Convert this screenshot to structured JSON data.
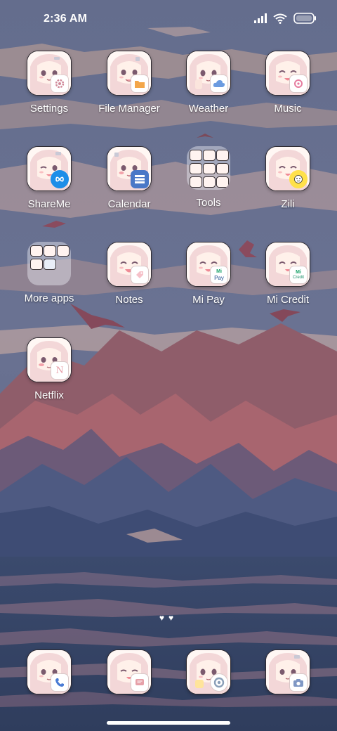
{
  "status_bar": {
    "time": "2:36 AM"
  },
  "apps": [
    {
      "id": "settings",
      "label": "Settings",
      "badge_icon": "gear-icon"
    },
    {
      "id": "file-manager",
      "label": "File Manager",
      "badge_icon": "folder-icon"
    },
    {
      "id": "weather",
      "label": "Weather",
      "badge_icon": "cloud-icon"
    },
    {
      "id": "music",
      "label": "Music",
      "badge_icon": "music-icon"
    },
    {
      "id": "shareme",
      "label": "ShareMe",
      "badge_icon": "infinity-icon"
    },
    {
      "id": "calendar",
      "label": "Calendar",
      "badge_icon": "calendar-icon"
    },
    {
      "id": "tools",
      "label": "Tools",
      "badge_icon": "folder-grid-icon"
    },
    {
      "id": "zili",
      "label": "Zili",
      "badge_icon": "zili-icon"
    },
    {
      "id": "more-apps",
      "label": "More apps",
      "badge_icon": "folder-grid-icon"
    },
    {
      "id": "notes",
      "label": "Notes",
      "badge_icon": "tag-icon"
    },
    {
      "id": "mi-pay",
      "label": "Mi Pay",
      "badge_text": "Pay"
    },
    {
      "id": "mi-credit",
      "label": "Mi Credit",
      "badge_text": "Credit"
    },
    {
      "id": "netflix",
      "label": "Netflix",
      "badge_text": "N"
    }
  ],
  "dock": [
    {
      "id": "phone",
      "badge_icon": "phone-icon"
    },
    {
      "id": "messages",
      "badge_icon": "message-icon"
    },
    {
      "id": "browser",
      "badge_icon": "browser-icon"
    },
    {
      "id": "camera",
      "badge_icon": "camera-icon"
    }
  ],
  "pager": {
    "dots": "♥♥"
  },
  "colors": {
    "sky": "#67708f",
    "cloud": "#b79e9e",
    "mountain": "#a8656f",
    "sea": "#3f4e72",
    "label": "#ffffff"
  }
}
